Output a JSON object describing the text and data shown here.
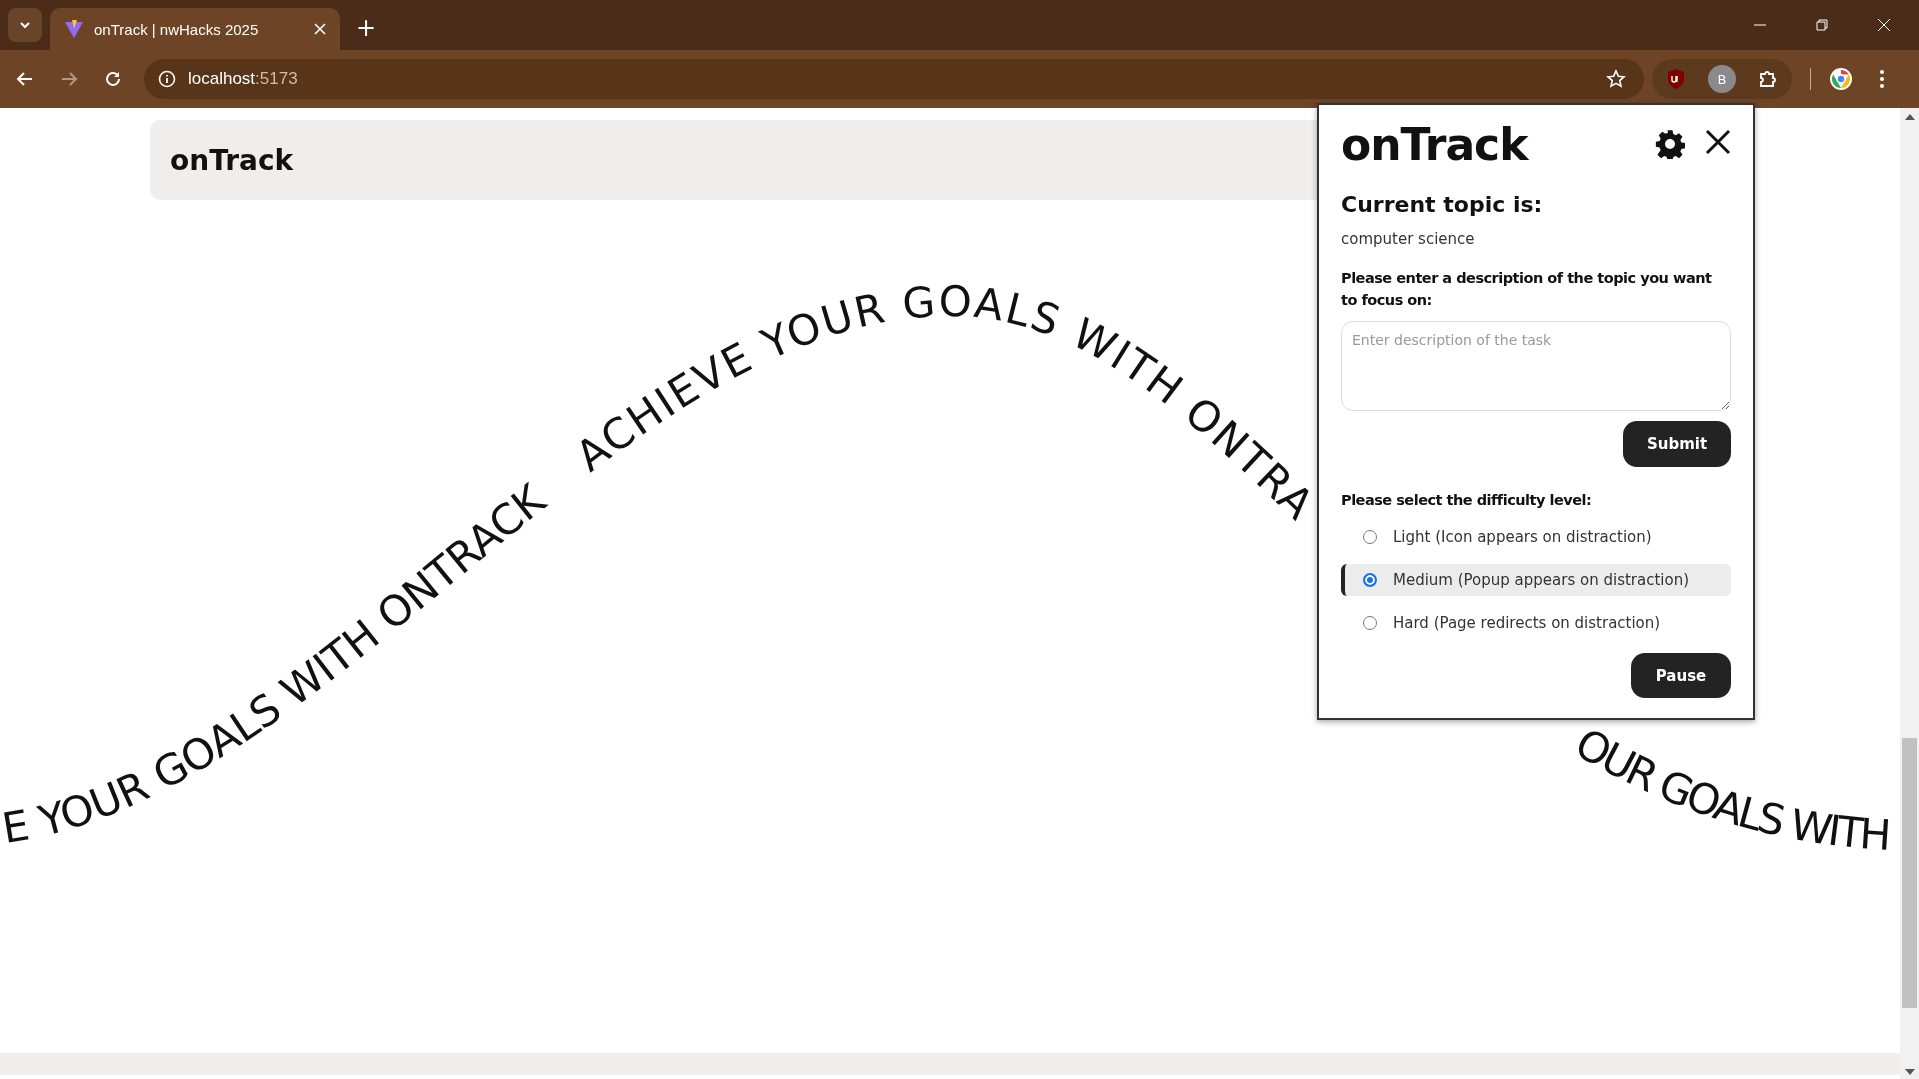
{
  "browser": {
    "tab": {
      "title": "onTrack | nwHacks 2025",
      "selected": true
    },
    "new_tab": "+",
    "address": {
      "host": "localhost",
      "port": ":5173"
    },
    "profile_badge": "B"
  },
  "page": {
    "header": {
      "title": "onTrack"
    },
    "wave_text": [
      {
        "text": "E YOUR GOALS WITH ONTRACK"
      },
      {
        "text": "ACHIEVE YOUR GOALS WITH ONTRA"
      },
      {
        "text": "OUR GOALS WITH"
      }
    ]
  },
  "popup": {
    "title": "onTrack",
    "topic_heading": "Current topic is:",
    "topic": "computer science",
    "description_label": "Please enter a description of the topic you want to focus on:",
    "description": {
      "placeholder": "Enter description of the task"
    },
    "submit": "Submit",
    "difficulty_label": "Please select the difficulty level:",
    "options": [
      {
        "label": "Light (Icon appears on distraction)",
        "selected": false
      },
      {
        "label": "Medium (Popup appears on distraction)",
        "selected": true
      },
      {
        "label": "Hard (Page redirects on distraction)",
        "selected": false
      }
    ],
    "pause": "Pause"
  }
}
